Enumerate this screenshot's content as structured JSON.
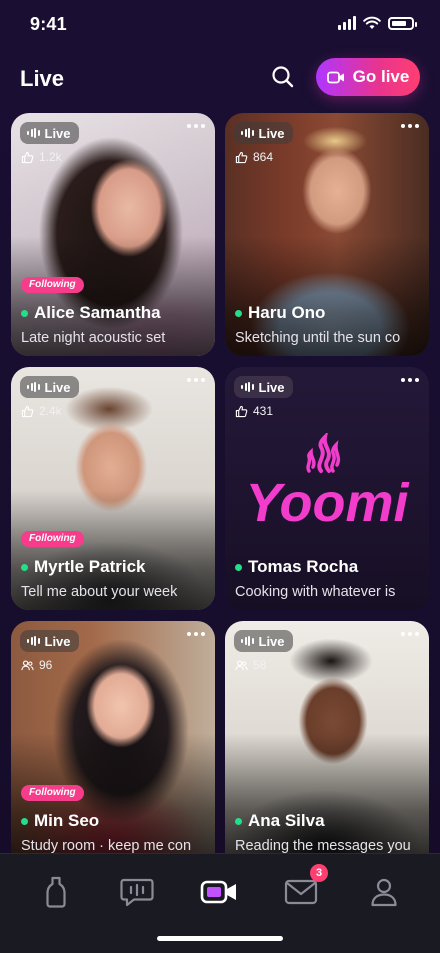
{
  "status": {
    "time": "9:41"
  },
  "header": {
    "title": "Live",
    "go_live_label": "Go live"
  },
  "live_label": "Live",
  "following_label": "Following",
  "cards": [
    {
      "name": "Alice Samantha",
      "subtitle": "Late night acoustic set",
      "stat": "1.2k",
      "stat_icon": "thumbs-up-icon",
      "following": true
    },
    {
      "name": "Haru Ono",
      "subtitle": "Sketching until the sun co",
      "stat": "864",
      "stat_icon": "thumbs-up-icon",
      "following": false
    },
    {
      "name": "Myrtle Patrick",
      "subtitle": "Tell me about your week",
      "stat": "2.4k",
      "stat_icon": "thumbs-up-icon",
      "following": true
    },
    {
      "name": "Tomas Rocha",
      "subtitle": "Cooking with whatever is",
      "stat": "431",
      "stat_icon": "thumbs-up-icon",
      "following": false,
      "logo_text": "Yoomi"
    },
    {
      "name": "Min Seo",
      "subtitle": "Study room · keep me con",
      "stat": "96",
      "stat_icon": "viewers-icon",
      "following": true
    },
    {
      "name": "Ana Silva",
      "subtitle": "Reading the messages you",
      "stat": "58",
      "stat_icon": "viewers-icon",
      "following": false
    }
  ],
  "tabbar": {
    "messages_badge": "3"
  },
  "colors": {
    "accent_pink": "#f63c8a",
    "live_dot": "#21e08a",
    "go_live_from": "#b036ff",
    "go_live_to": "#ff3e71"
  }
}
